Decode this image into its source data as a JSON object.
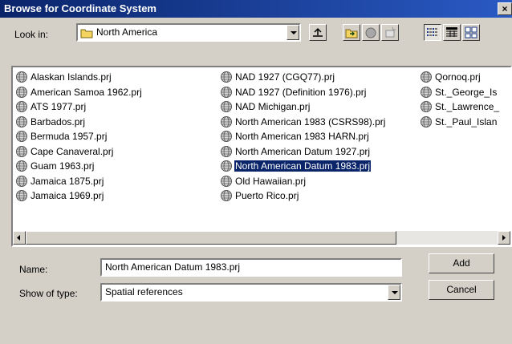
{
  "window": {
    "title": "Browse for Coordinate System",
    "close_label": "×"
  },
  "look_in": {
    "label": "Look in:",
    "value": "North America"
  },
  "toolbar": {
    "buttons": [
      "up-one-level-icon",
      "connect-folder-icon",
      "disconnect-folder-icon",
      "new-icon",
      "list-view-icon",
      "details-view-icon",
      "thumbnails-view-icon"
    ]
  },
  "files": {
    "col1": [
      "Alaskan Islands.prj",
      "American Samoa 1962.prj",
      "ATS 1977.prj",
      "Barbados.prj",
      "Bermuda 1957.prj",
      "Cape Canaveral.prj",
      "Guam 1963.prj",
      "Jamaica 1875.prj",
      "Jamaica 1969.prj"
    ],
    "col2": [
      "NAD 1927 (CGQ77).prj",
      "NAD 1927 (Definition 1976).prj",
      "NAD Michigan.prj",
      "North American 1983 (CSRS98).prj",
      "North American 1983 HARN.prj",
      "North American Datum 1927.prj",
      "North American Datum 1983.prj",
      "Old Hawaiian.prj",
      "Puerto Rico.prj"
    ],
    "col3": [
      "Qornoq.prj",
      "St._George_Is",
      "St._Lawrence_",
      "St._Paul_Islan"
    ],
    "selected": "North American Datum 1983.prj"
  },
  "name_field": {
    "label": "Name:",
    "value": "North American Datum 1983.prj"
  },
  "type_field": {
    "label": "Show of type:",
    "value": "Spatial references"
  },
  "buttons": {
    "add": "Add",
    "cancel": "Cancel"
  },
  "colors": {
    "title_start": "#0a246a",
    "title_end": "#2a5ac4",
    "selection": "#0a246a",
    "face": "#d4d0c8"
  }
}
